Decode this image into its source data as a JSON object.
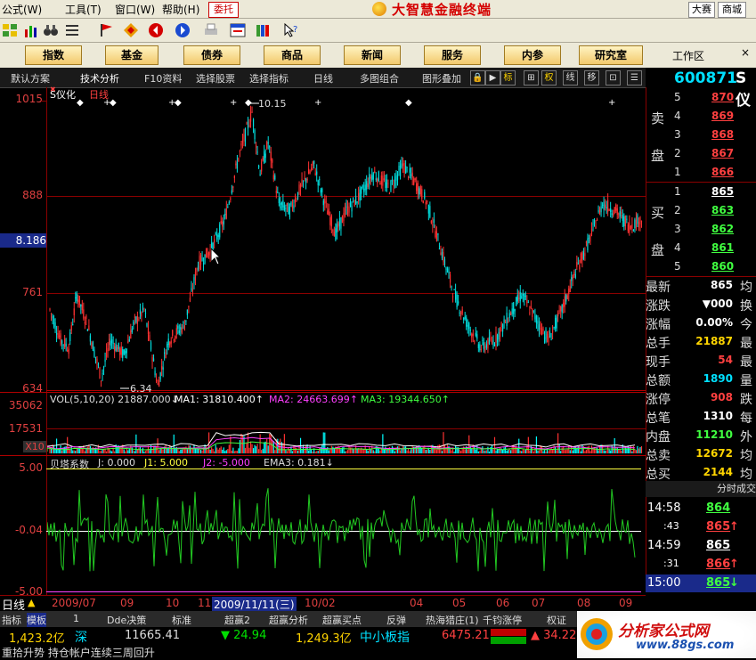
{
  "menu": {
    "items": [
      "公式(W)",
      "工具(T)",
      "窗口(W)",
      "帮助(H)"
    ],
    "trade_btn": "委托",
    "app_title": "大智慧金融终端",
    "right_tabs": [
      "大赛",
      "商城"
    ]
  },
  "nav": {
    "buttons": [
      "指数",
      "基金",
      "债券",
      "商品",
      "新闻",
      "服务",
      "内参",
      "研究室"
    ],
    "workarea": "工作区",
    "close": "×"
  },
  "tabs": {
    "items": [
      "默认方案",
      "技术分析",
      "F10资料",
      "选择股票",
      "选择指标",
      "日线",
      "多图组合",
      "图形叠加"
    ],
    "icons": [
      "标",
      "权",
      "线",
      "移"
    ]
  },
  "stock": {
    "code": "600871",
    "suffix": "S仪"
  },
  "main_chart": {
    "name": "S仪化",
    "period": "日线",
    "y_ticks": [
      "1015",
      "888",
      "761",
      "634"
    ],
    "cursor_value": "8.186",
    "high_label": "10.15",
    "low_label": "6.34"
  },
  "volume": {
    "legend": "VOL(5,10,20) 21887.000↓",
    "ma1": "MA1: 31810.400↑",
    "ma2": "MA2: 24663.699↑",
    "ma3": "MA3: 19344.650↑",
    "y_ticks": [
      "35062",
      "17531"
    ],
    "unit": "X10"
  },
  "indicator": {
    "name": "贝塔系数",
    "j": "J: 0.000",
    "j1": "J1: 5.000",
    "j2": "J2: -5.000",
    "ema3": "EMA3: 0.181↓",
    "y_ticks": [
      "5.00",
      "-0.04",
      "-5.00"
    ]
  },
  "dates": [
    "2009/07",
    "09",
    "10",
    "11",
    "2009/11/11(三)",
    "10/02",
    "04",
    "05",
    "06",
    "07",
    "08",
    "09"
  ],
  "orderbook": {
    "sell_label": [
      "卖",
      "盘"
    ],
    "buy_label": [
      "买",
      "盘"
    ],
    "sell": [
      {
        "n": "5",
        "p": "870"
      },
      {
        "n": "4",
        "p": "869"
      },
      {
        "n": "3",
        "p": "868"
      },
      {
        "n": "2",
        "p": "867"
      },
      {
        "n": "1",
        "p": "866"
      }
    ],
    "buy": [
      {
        "n": "1",
        "p": "865"
      },
      {
        "n": "2",
        "p": "863"
      },
      {
        "n": "3",
        "p": "862"
      },
      {
        "n": "4",
        "p": "861"
      },
      {
        "n": "5",
        "p": "860"
      }
    ]
  },
  "quote": [
    {
      "k": "最新",
      "v": "865",
      "r": "均"
    },
    {
      "k": "涨跌",
      "v": "▼000",
      "r": "换"
    },
    {
      "k": "涨幅",
      "v": "0.00%",
      "r": "今"
    },
    {
      "k": "总手",
      "v": "21887",
      "r": "最"
    },
    {
      "k": "现手",
      "v": "54",
      "r": "最"
    },
    {
      "k": "总额",
      "v": "1890",
      "r": "量"
    },
    {
      "k": "涨停",
      "v": "908",
      "r": "跌"
    },
    {
      "k": "总笔",
      "v": "1310",
      "r": "每"
    },
    {
      "k": "内盘",
      "v": "11210",
      "r": "外"
    },
    {
      "k": "总卖",
      "v": "12672",
      "r": "均"
    },
    {
      "k": "总买",
      "v": "2144",
      "r": "均"
    }
  ],
  "ticks": {
    "header": "分时成交",
    "rows": [
      {
        "t": "14:58",
        "p": "864",
        "dir": ""
      },
      {
        "t": ":43",
        "p": "865",
        "dir": "↑"
      },
      {
        "t": "14:59",
        "p": "865",
        "dir": ""
      },
      {
        "t": ":31",
        "p": "866",
        "dir": "↑"
      },
      {
        "t": "15:00",
        "p": "865",
        "dir": "↓"
      }
    ]
  },
  "indicator_tabs": [
    "指标",
    "模板",
    "1",
    "Dde决策",
    "标准",
    "超赢2",
    "超赢分析",
    "超赢买点",
    "反弹",
    "热海猎庄(1)",
    "千钧涨停",
    "权证"
  ],
  "status": {
    "sh_amount": "1,423.2亿",
    "sz_label": "深",
    "sz_index": "11665.41",
    "sz_change": "▼ 24.94",
    "sz_amount": "1,249.3亿",
    "sme_label": "中小板指",
    "sme_index": "6475.21",
    "sme_change": "▲ 34.22"
  },
  "marquee": "重拾升势 持仓帐户连续三周回升",
  "watermark": {
    "text": "分析家公式网",
    "url": "www.88gs.com"
  },
  "colors": {
    "up": "#ff3232",
    "down": "#00e0e0",
    "flat": "#ffffff",
    "vol_up": "#ff3232",
    "vol_down": "#00ffff",
    "beta_line": "#22c922"
  }
}
